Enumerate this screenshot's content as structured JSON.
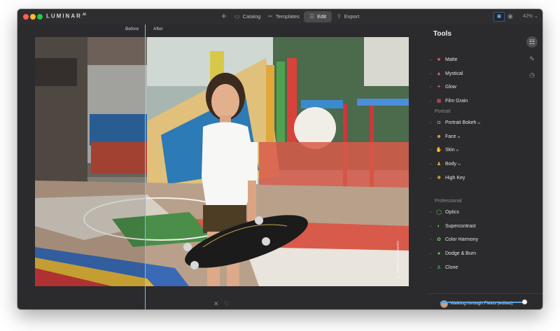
{
  "app": {
    "name": "LUMINAR",
    "version": "AI",
    "colors": {
      "close": "#ff5f57",
      "minimize": "#febc2e",
      "maximize": "#28c840",
      "accent": "#5a9fe0"
    }
  },
  "toolbar": {
    "plus_icon": "plus-icon",
    "catalog_label": "Catalog",
    "templates_label": "Templates",
    "edit_label": "Edit",
    "export_label": "Export",
    "zoom_label": "42% ⌄"
  },
  "canvas": {
    "before_label": "Before",
    "after_label": "After",
    "watermark": "© Maryna Yurchenko",
    "reject_icon": "✕",
    "favorite_icon": "♡"
  },
  "panel": {
    "title": "Tools",
    "sections": [
      {
        "header": "",
        "items": [
          {
            "label": "Matte",
            "icon": "■",
            "color": "#e0555f",
            "ai": false
          },
          {
            "label": "Mystical",
            "icon": "▲",
            "color": "#e06a8a",
            "ai": false
          },
          {
            "label": "Glow",
            "icon": "✦",
            "color": "#e0606a",
            "ai": false
          },
          {
            "label": "Film Grain",
            "icon": "▦",
            "color": "#e05560",
            "ai": false
          }
        ]
      },
      {
        "header": "Portrait",
        "items": [
          {
            "label": "Portrait Bokeh",
            "icon": "◘",
            "color": "#e8a640",
            "ai": true
          },
          {
            "label": "Face",
            "icon": "☻",
            "color": "#e8a640",
            "ai": true
          },
          {
            "label": "Skin",
            "icon": "✋",
            "color": "#e8a640",
            "ai": true
          },
          {
            "label": "Body",
            "icon": "♟",
            "color": "#e8a640",
            "ai": true
          },
          {
            "label": "High Key",
            "icon": "✺",
            "color": "#e8a640",
            "ai": false
          }
        ]
      },
      {
        "header": "Professional",
        "items": [
          {
            "label": "Optics",
            "icon": "◯",
            "color": "#6ad36a",
            "ai": false
          },
          {
            "label": "Supercontrast",
            "icon": "◐",
            "color": "#6ad36a",
            "ai": false
          },
          {
            "label": "Color Harmony",
            "icon": "✿",
            "color": "#6ad36a",
            "ai": false
          },
          {
            "label": "Dodge & Burn",
            "icon": "●",
            "color": "#6ad36a",
            "ai": false
          },
          {
            "label": "Clone",
            "icon": "♙",
            "color": "#6ad36a",
            "ai": false
          }
        ]
      }
    ],
    "ai_badge": "AI",
    "side_icons": [
      "sliders-icon",
      "brush-icon",
      "history-icon"
    ],
    "preset": {
      "name": "Walking through Fields (edited)",
      "more": "···",
      "amount_percent": 100
    }
  }
}
